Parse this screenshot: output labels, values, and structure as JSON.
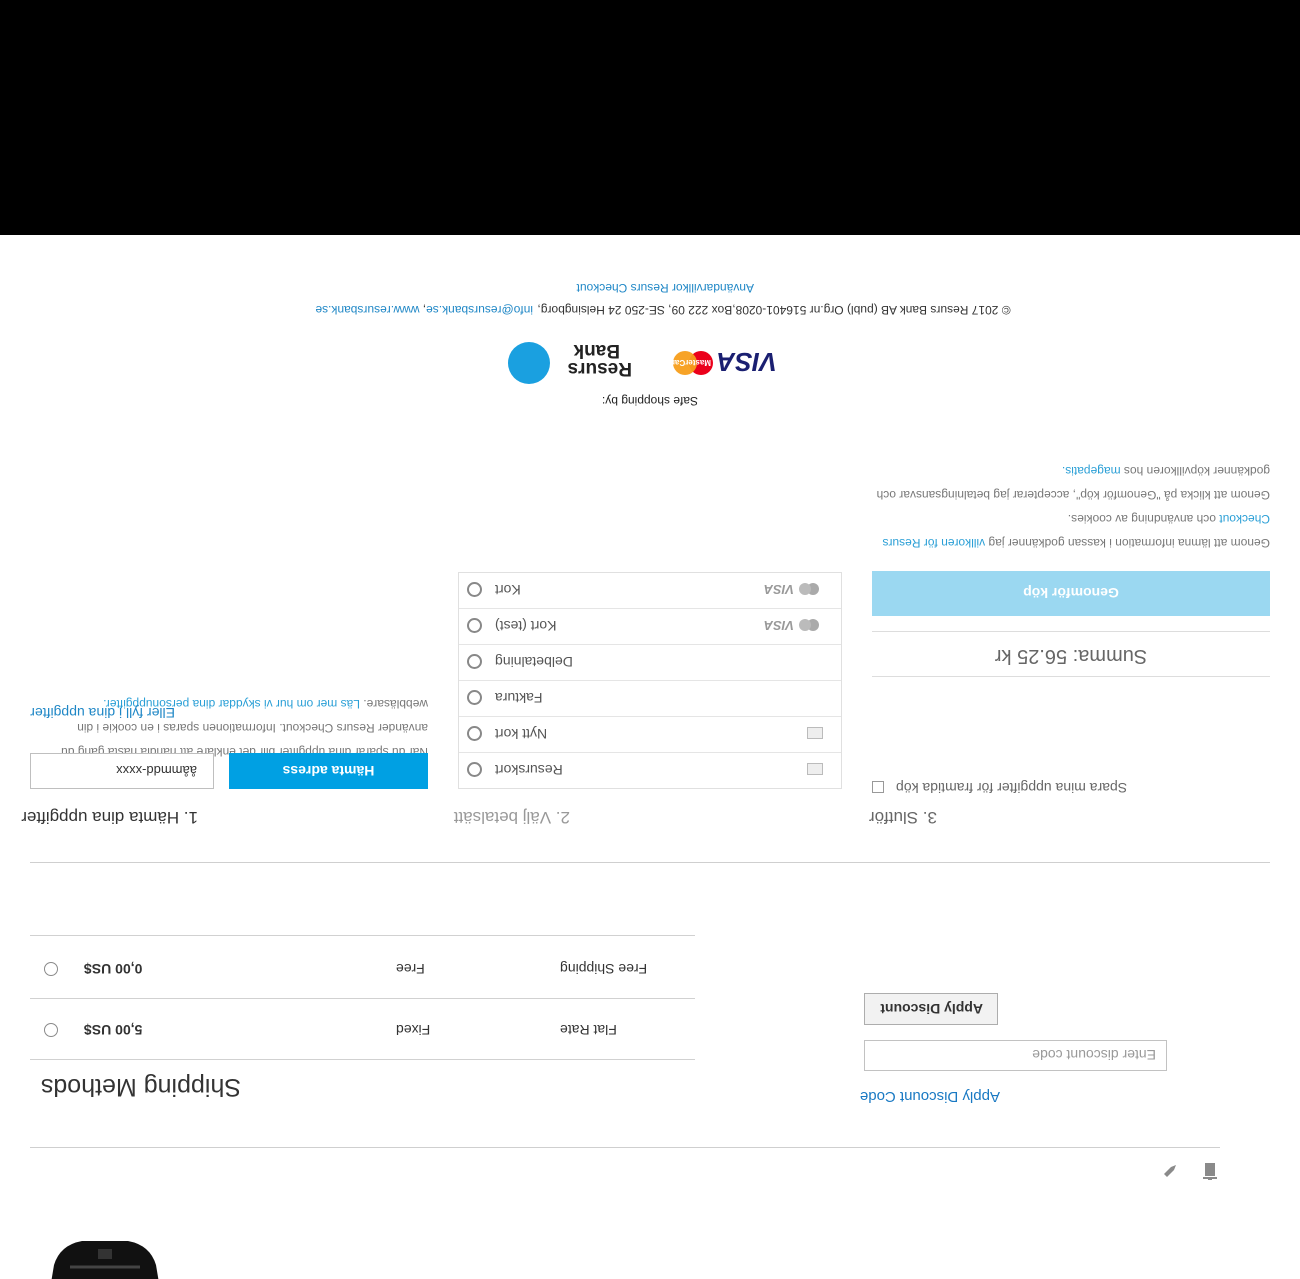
{
  "product": {
    "image_alt": "Backpack"
  },
  "actions": {
    "edit_icon": "pencil-icon",
    "delete_icon": "trash-icon"
  },
  "discount": {
    "title": "Apply Discount Code",
    "placeholder": "Enter discount code",
    "button": "Apply Discount"
  },
  "shipping": {
    "title": "Shipping Methods",
    "methods": [
      {
        "price": "5,00 US$",
        "type": "Fixed",
        "name": "Flat Rate"
      },
      {
        "price": "0,00 US$",
        "type": "Free",
        "name": "Free Shipping"
      }
    ]
  },
  "checkout": {
    "step1": {
      "title": "1. Hämta dina uppgifter",
      "input_value": "ååmmdd-xxxx",
      "button": "Hämta adress",
      "manual_link": "Eller fyll i dina uppgifter"
    },
    "step2": {
      "title": "2. Välj betalsätt",
      "options": [
        {
          "label": "Resurskort"
        },
        {
          "label": "Nytt kort"
        },
        {
          "label": "Faktura"
        },
        {
          "label": "Delbetalning"
        },
        {
          "label": "Kort (test)"
        },
        {
          "label": "Kort"
        }
      ]
    },
    "step3": {
      "title": "3. Slutför",
      "save_label": "Spara mina uppgifter för framtida köp",
      "save_info_1": "När du sparar dina uppgifter blir det enklare att handla nästa gång du",
      "save_info_2": "använder Resurs Checkout. Informationen sparas i en cookie i din",
      "save_info_3": "webbläsare.",
      "save_link": "Läs mer om hur vi skyddar dina personuppgifter.",
      "total": "Summa: 56.25 kr",
      "button": "Genomför köp",
      "terms_1a": "Genom att lämna information i kassan godkänner jag",
      "terms_1_link": "villkoren för Resurs",
      "terms_2_link": "Checkout",
      "terms_2b": "och användning av cookies.",
      "terms_3": "Genom att klicka på \"Genomför köp\", accepterar jag betalningsansvar och",
      "terms_4a": "godkänner köpvillkoren hos",
      "terms_4_link": "magepatis."
    }
  },
  "footer": {
    "safe_shopping": "Safe shopping by:",
    "visa": "VISA",
    "mastercard": "MasterCard",
    "resurs_line1": "Resurs",
    "resurs_line2": "Bank",
    "copyright": "© 2017 Resurs Bank AB (publ) Org.nr 516401-0208,Box 222 09, SE-250 24 Helsingborg,",
    "email": "info@resursbank.se",
    "website": "www.resursbank.se",
    "terms_link": "Användarvillkor Resurs Checkout"
  },
  "colors": {
    "accent": "#00a0e3",
    "link": "#1979c3",
    "disabled_button": "#9bd8f1",
    "band": "#000000"
  }
}
